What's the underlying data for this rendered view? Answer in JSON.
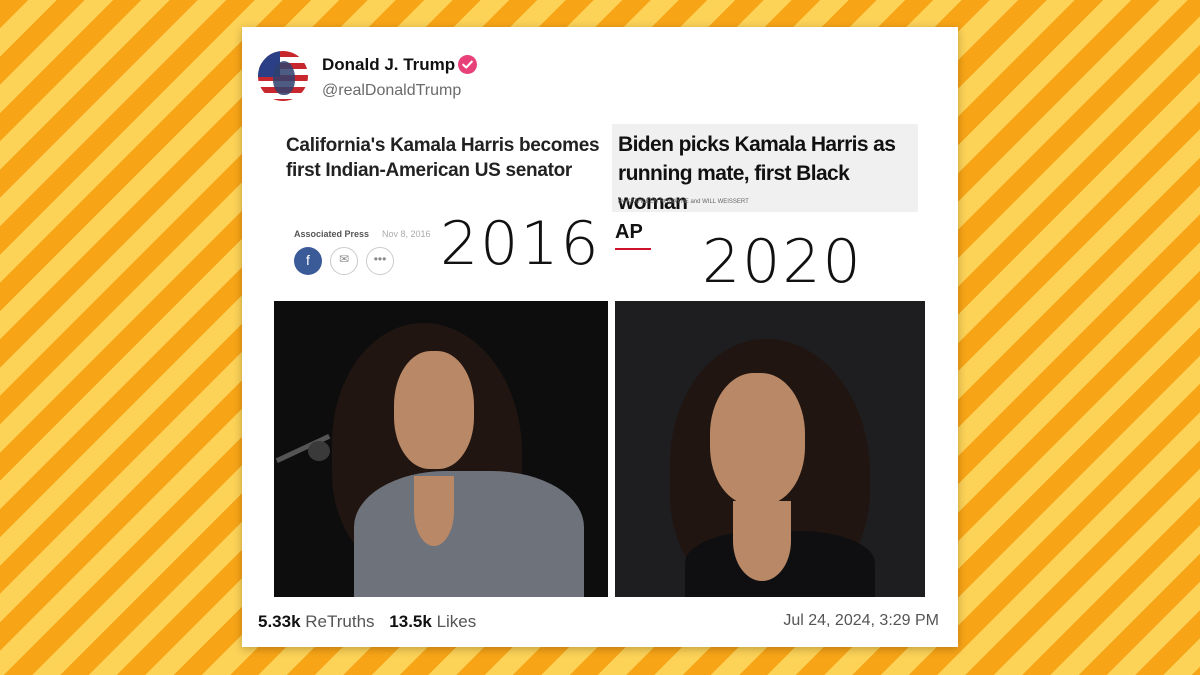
{
  "post": {
    "author_name": "Donald J. Trump",
    "author_handle": "@realDonaldTrump",
    "verified_icon": "verified-badge-icon",
    "retruths_count": "5.33k",
    "retruths_label": "ReTruths",
    "likes_count": "13.5k",
    "likes_label": "Likes",
    "timestamp": "Jul 24, 2024, 3:29 PM"
  },
  "image": {
    "left_headline": "California's Kamala Harris becomes first Indian-American US senator",
    "left_source": "Associated Press",
    "left_date_blur": "Nov 8, 2016",
    "right_headline": "Biden picks Kamala Harris as running mate, first Black woman",
    "right_byline": "By KATHLEEN RONAYNE and WILL WEISSERT",
    "right_outlet": "AP",
    "year_left": "2016",
    "year_right": "2020"
  },
  "colors": {
    "stripe_dark": "#f7a417",
    "stripe_light": "#fcd257",
    "verified": "#e8417a",
    "ap_red": "#d0112b"
  }
}
